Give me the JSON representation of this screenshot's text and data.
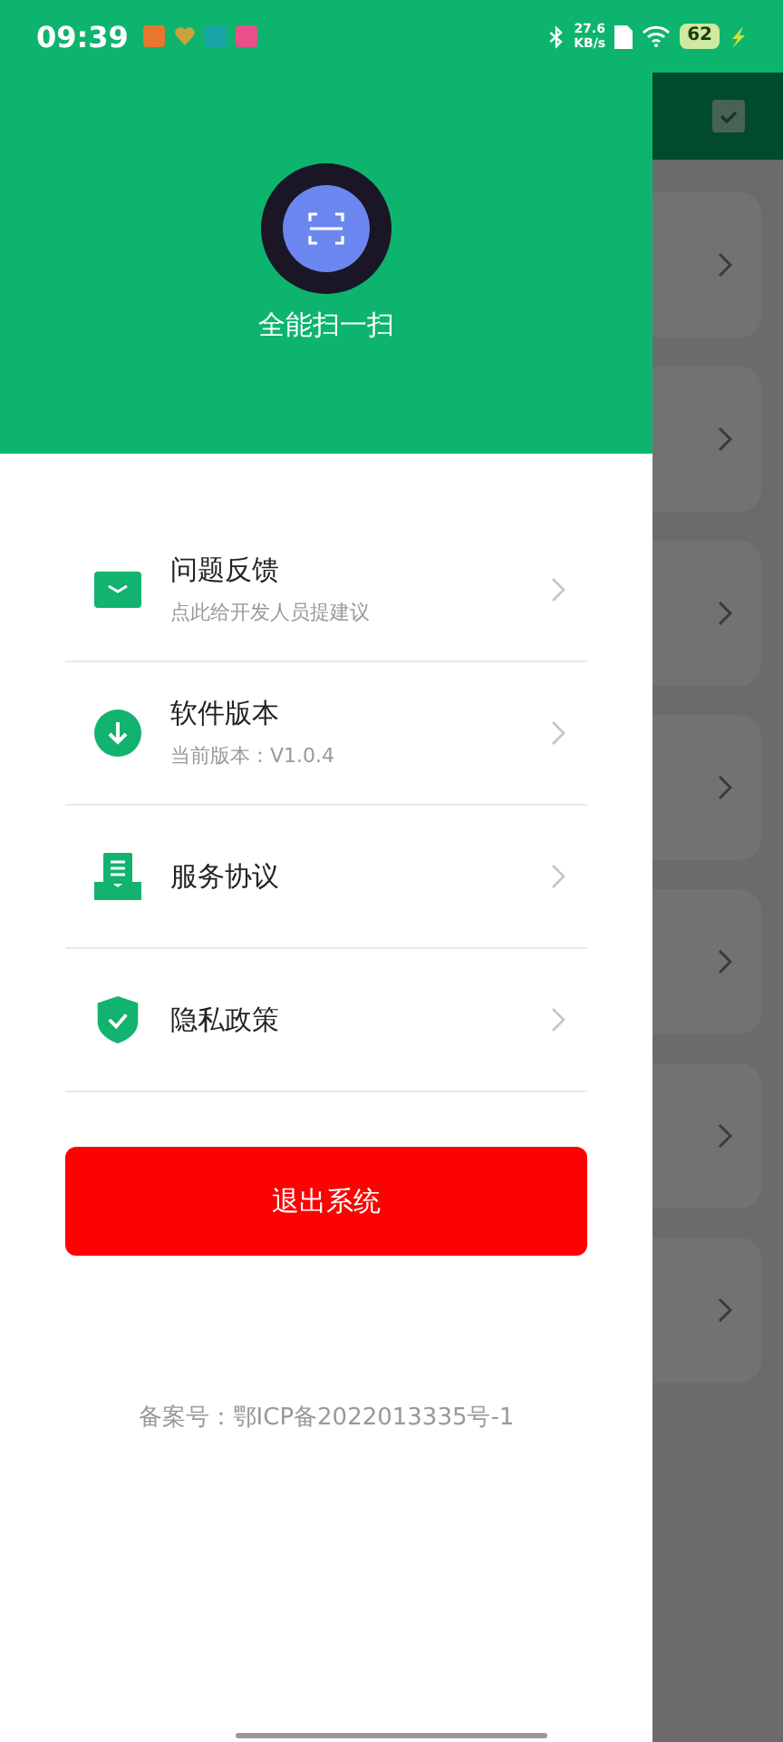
{
  "status_bar": {
    "time": "09:39",
    "speed_value": "27.6",
    "speed_unit": "KB/s",
    "battery": "62"
  },
  "drawer": {
    "title": "全能扫一扫",
    "menu": [
      {
        "kind": "mail",
        "title": "问题反馈",
        "subtitle": "点此给开发人员提建议"
      },
      {
        "kind": "download",
        "title": "软件版本",
        "subtitle": "当前版本：V1.0.4"
      },
      {
        "kind": "document",
        "title": "服务协议"
      },
      {
        "kind": "shield",
        "title": "隐私政策"
      }
    ],
    "logout_button": "退出系统",
    "footer": "备案号：鄂ICP备2022013335号-1"
  },
  "background_cards": [
    {
      "kind": "card"
    },
    {
      "kind": "card"
    },
    {
      "kind": "card"
    },
    {
      "kind": "card"
    },
    {
      "kind": "card"
    },
    {
      "kind": "card"
    },
    {
      "kind": "card"
    }
  ]
}
